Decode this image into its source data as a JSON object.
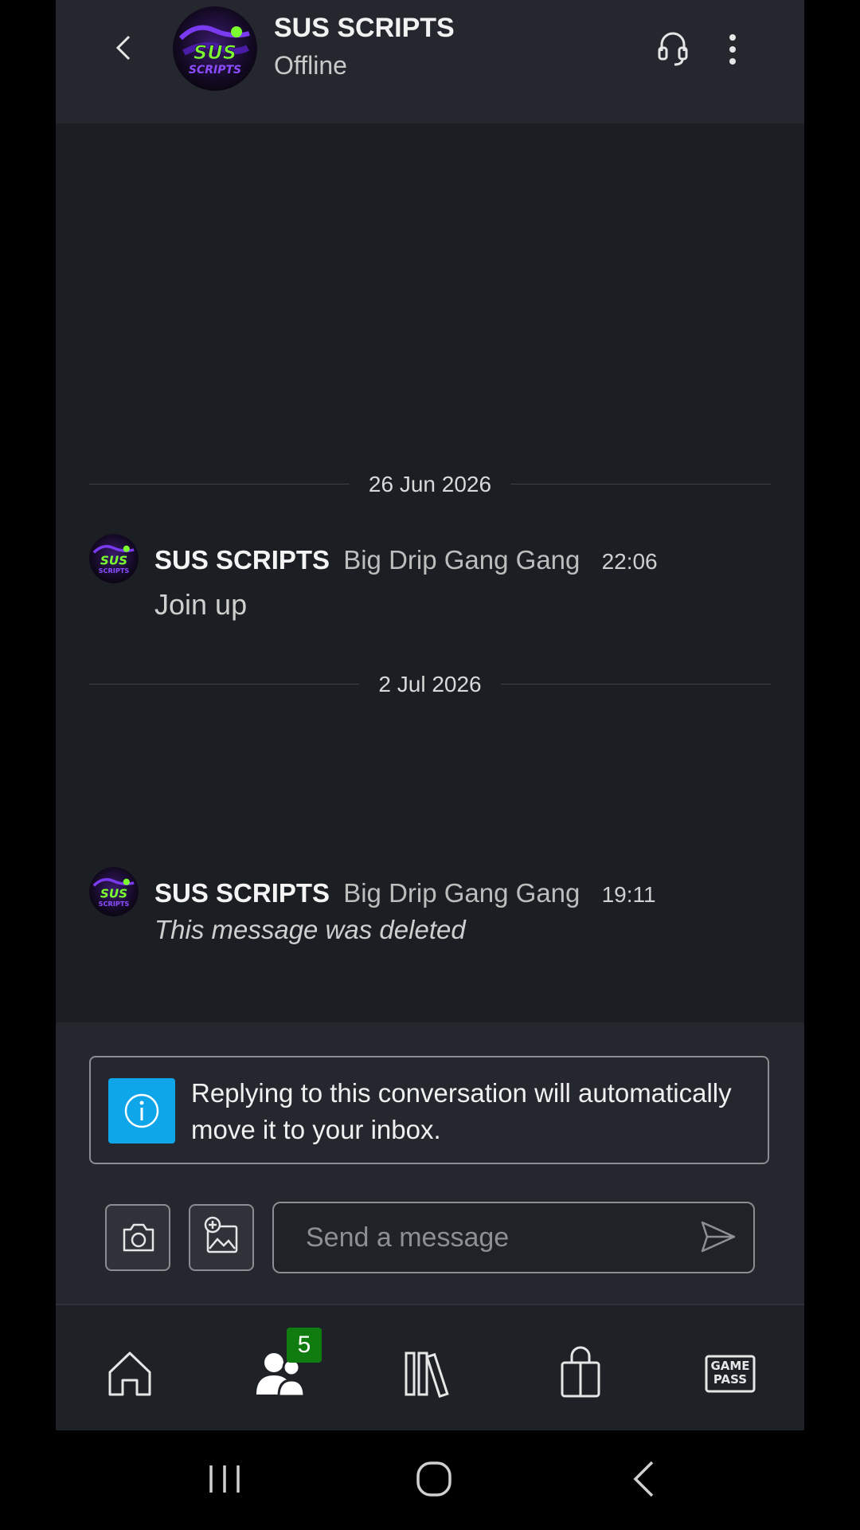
{
  "header": {
    "title": "SUS SCRIPTS",
    "status": "Offline",
    "avatar_text": "SUS SCRIPTS"
  },
  "conversation": {
    "groups": [
      {
        "date": "26 Jun 2026",
        "message": {
          "sender": "SUS SCRIPTS",
          "gamertag": "Big Drip Gang Gang",
          "time": "22:06",
          "text": "Join up",
          "deleted": false
        }
      },
      {
        "date": "2 Jul 2026",
        "message": {
          "sender": "SUS SCRIPTS",
          "gamertag": "Big Drip Gang Gang",
          "time": "19:11",
          "text": "This message was deleted",
          "deleted": true
        }
      }
    ]
  },
  "composer": {
    "info_text": "Replying to this conversation will automatically move it to your inbox.",
    "placeholder": "Send a message",
    "camera_icon": "camera-icon",
    "image_icon": "add-image-icon",
    "send_icon": "send-icon"
  },
  "bottom_nav": {
    "items": [
      {
        "icon": "home-icon",
        "active": false
      },
      {
        "icon": "social-icon",
        "active": true,
        "badge": "5"
      },
      {
        "icon": "library-icon",
        "active": false
      },
      {
        "icon": "store-icon",
        "active": false
      },
      {
        "icon": "game-pass-icon",
        "active": false,
        "label": "GAME PASS"
      }
    ]
  },
  "colors": {
    "app_bg": "#1b1e23",
    "header_bg": "#24272d",
    "info_blue": "#0ea5e9",
    "badge_green": "#107c10",
    "avatar_green": "#7cff2e",
    "avatar_purple": "#6b2fd6"
  }
}
